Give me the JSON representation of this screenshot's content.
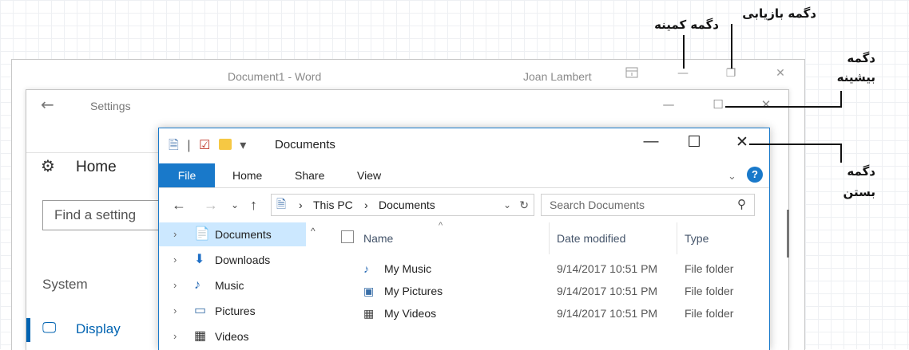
{
  "word": {
    "title": "Document1 - Word",
    "user": "Joan Lambert",
    "ribbon_display_icon": "ribbon-display-icon",
    "minimize": "—",
    "restore": "❐",
    "close": "✕"
  },
  "settings": {
    "back_icon": "←",
    "title": "Settings",
    "minimize": "—",
    "maximize": "☐",
    "close": "✕",
    "home_icon": "⚙",
    "home_label": "Home",
    "search_placeholder": "Find a setting",
    "section_label": "System",
    "display_icon": "🖵",
    "display_label": "Display"
  },
  "explorer": {
    "title": "Documents",
    "qat_divider": "|",
    "qat_dropdown": "▾",
    "minimize": "—",
    "maximize": "☐",
    "close": "✕",
    "tabs": {
      "file": "File",
      "home": "Home",
      "share": "Share",
      "view": "View"
    },
    "ribbon_expand": "⌄",
    "help": "?",
    "nav": {
      "back": "←",
      "forward": "→",
      "recent": "⌄",
      "up": "↑"
    },
    "address": {
      "sep1": "›",
      "crumb1": "This PC",
      "sep2": "›",
      "crumb2": "Documents",
      "dropdown": "⌄",
      "refresh": "↻"
    },
    "search_placeholder": "Search Documents",
    "search_icon": "⚲",
    "nav_pane": {
      "expander": "›",
      "collapse": "^",
      "items": [
        {
          "label": "Documents",
          "icon": "📄"
        },
        {
          "label": "Downloads",
          "icon": "⬇"
        },
        {
          "label": "Music",
          "icon": "♪"
        },
        {
          "label": "Pictures",
          "icon": "▭"
        },
        {
          "label": "Videos",
          "icon": "▦"
        }
      ]
    },
    "columns": {
      "name": "Name",
      "date": "Date modified",
      "type": "Type",
      "sort": "^"
    },
    "files": [
      {
        "icon": "♪",
        "name": "My Music",
        "date": "9/14/2017 10:51 PM",
        "type": "File folder"
      },
      {
        "icon": "▣",
        "name": "My Pictures",
        "date": "9/14/2017 10:51 PM",
        "type": "File folder"
      },
      {
        "icon": "▦",
        "name": "My Videos",
        "date": "9/14/2017 10:51 PM",
        "type": "File folder"
      }
    ]
  },
  "annotations": {
    "restore": "دگمه بازیابی",
    "minimize": "دگمه کمینه",
    "maximize_1": "دگمه",
    "maximize_2": "بیشینه",
    "close_1": "دگمه",
    "close_2": "بستن"
  },
  "colors": {
    "accent": "#1979ca",
    "selection": "#cce8ff",
    "settings_accent": "#0063b1"
  }
}
